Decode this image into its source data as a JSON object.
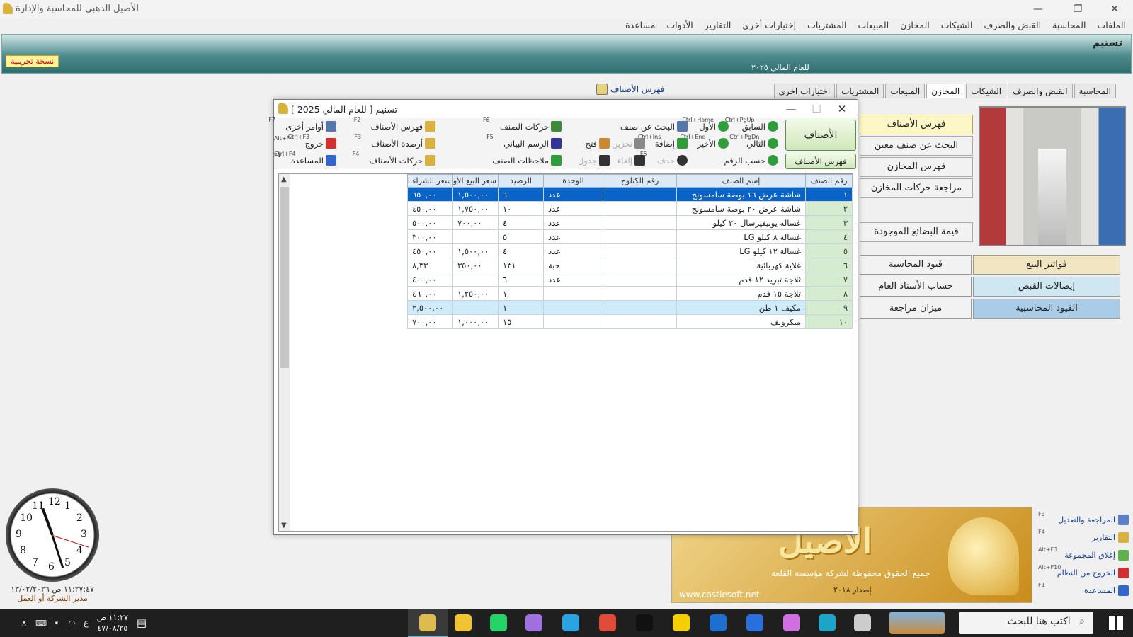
{
  "app": {
    "title": "الأصيل الذهبي للمحاسبة والإدارة",
    "trial_badge": "نسخة تجريبية"
  },
  "menubar": [
    "الملفات",
    "المحاسبة",
    "القبض والصرف",
    "الشيكات",
    "المخازن",
    "المبيعات",
    "المشتريات",
    "إختيارات أخرى",
    "التقارير",
    "الأدوات",
    "مساعدة"
  ],
  "banner": {
    "company": "تسنيم",
    "fiscal_year": "للعام المالي ٢٠٢٥"
  },
  "main_tabs": [
    "المحاسبة",
    "القبض والصرف",
    "الشيكات",
    "المخازن",
    "المبيعات",
    "المشتريات",
    "اختيارات اخرى"
  ],
  "main_tab_active": "المخازن",
  "catalog_tab": "فهرس الأصناف",
  "side_menu": [
    "فهرس الأصناف",
    "البحث عن صنف معين",
    "فهرس المخازن",
    "مراجعة حركات المخازن",
    "قيمة البضائع الموجودة"
  ],
  "side_left": [
    "قيود المحاسبة",
    "حساب الأستاذ العام",
    "ميزان مراجعة"
  ],
  "side_right": [
    "فواتير البيع",
    "إيصالات القبض",
    "القيود المحاسبية"
  ],
  "logo": {
    "brand": "الأصيل",
    "rights": "جميع الحقوق محفوظة لشركة مؤسسة القلعة",
    "version": "إصدار ٢٠١٨",
    "website": "www.castlesoft.net"
  },
  "quick_links": [
    {
      "label": "المراجعة والتعديل",
      "key": "F3"
    },
    {
      "label": "التقارير",
      "key": "F4"
    },
    {
      "label": "إغلاق المجموعة",
      "key": "Alt+F3"
    },
    {
      "label": "الخروج من النظام",
      "key": "Alt+F10"
    },
    {
      "label": "المساعدة",
      "key": "F1"
    }
  ],
  "clock": {
    "datetime": "١١:٢٧:٤٧ ص ١٣/٠٢/٢٠٢٦",
    "role": "مدير الشركة أو العمل",
    "numerals": [
      "12",
      "1",
      "2",
      "3",
      "4",
      "5",
      "6",
      "7",
      "8",
      "9",
      "10",
      "11"
    ]
  },
  "dialog": {
    "title": "تسنيم  [ للعام المالي 2025 ]",
    "big_button": "الأصناف",
    "catalog_button": "فهرس الأصناف",
    "toolbar_row1": [
      {
        "label": "السابق",
        "key": "Ctrl+PgUp",
        "color": "#2e9d3a"
      },
      {
        "label": "الأول",
        "key": "Ctrl+Home",
        "color": "#2e9d3a"
      },
      {
        "label": "البحث عن صنف",
        "key": "",
        "color": "#5577aa"
      },
      {
        "label": "حركات الصنف",
        "key": "F6",
        "color": "#3a8a3a"
      },
      {
        "label": "فهرس الأصناف",
        "key": "F2",
        "color": "#d8b240"
      },
      {
        "label": "أوامر أخرى",
        "key": "F7",
        "color": "#5577aa"
      }
    ],
    "toolbar_row2": [
      {
        "label": "التالي",
        "key": "Ctrl+PgDn",
        "color": "#2e9d3a"
      },
      {
        "label": "الأخير",
        "key": "Ctrl+End",
        "color": "#2e9d3a"
      },
      {
        "label": "إضافة",
        "key": "Ctrl+Ins",
        "color": "#2e9d3a"
      },
      {
        "label": "تخزين",
        "key": "",
        "color": "#888888",
        "disabled": true
      },
      {
        "label": "فتح",
        "key": "",
        "color": "#cc8833"
      },
      {
        "label": "الرسم البياني",
        "key": "F5",
        "color": "#333399"
      },
      {
        "label": "أرصدة الأصناف",
        "key": "F3",
        "color": "#d8b240"
      },
      {
        "label": "خروج",
        "key": "Ctrl+F3",
        "color": "#d03030"
      }
    ],
    "toolbar_row3": [
      {
        "label": "حسب الرقم",
        "key": "",
        "color": "#2e9d3a"
      },
      {
        "label": "حذف",
        "key": "F5",
        "color": "#333333",
        "disabled": true
      },
      {
        "label": "إلغاء",
        "key": "",
        "color": "#333333",
        "disabled": true
      },
      {
        "label": "جدول",
        "key": "",
        "color": "#333333",
        "disabled": true
      },
      {
        "label": "ملاحظات الصنف",
        "key": "",
        "color": "#2e9d3a"
      },
      {
        "label": "حركات الأصناف",
        "key": "F4",
        "color": "#d8b240"
      },
      {
        "label": "المساعدة",
        "key": "Ctrl+F4",
        "color": "#3366cc"
      }
    ],
    "extra_keys": {
      "alt_f4": "Alt+F4",
      "f1": "F1"
    },
    "columns": [
      "رقم الصنف",
      "إسم الصنف",
      "رقم الكتلوج",
      "الوحدة",
      "الرصيد",
      "سعر البيع الأول",
      "سعر الشراء الأخير"
    ],
    "rows": [
      [
        "١",
        "شاشة عرض ١٦ بوصة سامسونج",
        "",
        "عدد",
        "٦",
        "١,٥٠٠,٠٠",
        "٦٥٠,٠٠"
      ],
      [
        "٢",
        "شاشة عرض ٢٠ بوصة سامسونج",
        "",
        "عدد",
        "١٠",
        "١,٧٥٠,٠٠",
        "٤٥٠,٠٠"
      ],
      [
        "٣",
        "غسالة يونيفيرسال ٢٠ كيلو",
        "",
        "عدد",
        "٤",
        "٧٠٠,٠٠",
        "٥٠٠,٠٠"
      ],
      [
        "٤",
        "غسالة ٨ كيلو LG",
        "",
        "عدد",
        "٥",
        "",
        "٣٠٠,٠٠"
      ],
      [
        "٥",
        "غسالة ١٢ كيلو LG",
        "",
        "عدد",
        "٤",
        "١,٥٠٠,٠٠",
        "٤٥٠,٠٠"
      ],
      [
        "٦",
        "غلاية كهربائية",
        "",
        "حبة",
        "١٣١",
        "٣٥٠,٠٠",
        "٨,٣٣"
      ],
      [
        "٧",
        "ثلاجة تبريد ١٢ قدم",
        "",
        "عدد",
        "٦",
        "",
        "٤٠٠,٠٠"
      ],
      [
        "٨",
        "ثلاجة ١٥ قدم",
        "",
        "",
        "١",
        "١,٢٥٠,٠٠",
        "٤٦٠,٠٠"
      ],
      [
        "٩",
        "مكيف ١ طن",
        "",
        "",
        "١",
        "",
        "٢,٥٠٠,٠٠"
      ],
      [
        "١٠",
        "ميكرويف",
        "",
        "",
        "١٥",
        "١,٠٠٠,٠٠",
        "٧٠٠,٠٠"
      ]
    ],
    "selected_row": 0,
    "highlighted_row": 8
  },
  "taskbar": {
    "search_placeholder": "اكتب هنا للبحث",
    "time": "١١:٢٧ ص",
    "date": "٤٧/٠٨/٢٥",
    "lang": "ع"
  }
}
